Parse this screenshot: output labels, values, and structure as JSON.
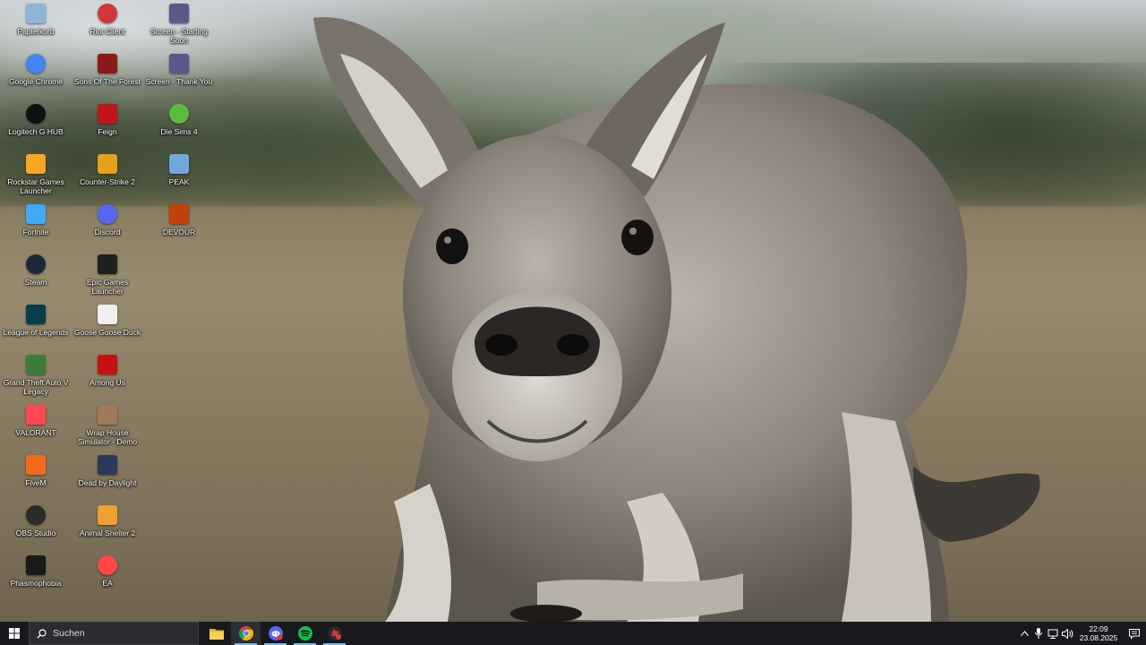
{
  "desktop": {
    "icons": [
      {
        "label": "Papierkorb",
        "icon": "recycle-bin-icon",
        "color": "#8fb3d9"
      },
      {
        "label": "Google Chrome",
        "icon": "chrome-icon",
        "color": "#4285f4"
      },
      {
        "label": "Logitech G HUB",
        "icon": "logitech-g-icon",
        "color": "#111111"
      },
      {
        "label": "Rockstar Games Launcher",
        "icon": "rockstar-icon",
        "color": "#f5a623"
      },
      {
        "label": "Fortnite",
        "icon": "fortnite-icon",
        "color": "#3fa9f5"
      },
      {
        "label": "Steam",
        "icon": "steam-icon",
        "color": "#1b2838"
      },
      {
        "label": "League of Legends",
        "icon": "league-of-legends-icon",
        "color": "#0a3d4a"
      },
      {
        "label": "Grand Theft Auto V Legacy",
        "icon": "gta-v-icon",
        "color": "#3c7d3a"
      },
      {
        "label": "VALORANT",
        "icon": "valorant-icon",
        "color": "#ff4655"
      },
      {
        "label": "FiveM",
        "icon": "fivem-icon",
        "color": "#f26b1d"
      },
      {
        "label": "OBS Studio",
        "icon": "obs-icon",
        "color": "#2b2b2b"
      },
      {
        "label": "Phasmophobia",
        "icon": "phasmophobia-icon",
        "color": "#1a1a1a"
      },
      {
        "label": "Riot Client",
        "icon": "riot-client-icon",
        "color": "#d13639"
      },
      {
        "label": "Sons Of The Forest",
        "icon": "sons-of-the-forest-icon",
        "color": "#8b1a1a"
      },
      {
        "label": "Feign",
        "icon": "feign-icon",
        "color": "#c0161b"
      },
      {
        "label": "Counter-Strike 2",
        "icon": "counter-strike-2-icon",
        "color": "#e4a11b"
      },
      {
        "label": "Discord",
        "icon": "discord-icon",
        "color": "#5865f2"
      },
      {
        "label": "Epic Games Launcher",
        "icon": "epic-games-icon",
        "color": "#202020"
      },
      {
        "label": "Goose Goose Duck",
        "icon": "goose-goose-duck-icon",
        "color": "#f0f0f0"
      },
      {
        "label": "Among Us",
        "icon": "among-us-icon",
        "color": "#c51111"
      },
      {
        "label": "Wrap House Simulator - Demo",
        "icon": "wrap-house-simulator-icon",
        "color": "#a0785a"
      },
      {
        "label": "Dead by Daylight",
        "icon": "dead-by-daylight-icon",
        "color": "#2a3a5a"
      },
      {
        "label": "Animal Shelter 2",
        "icon": "animal-shelter-2-icon",
        "color": "#f0a030"
      },
      {
        "label": "EA",
        "icon": "ea-icon",
        "color": "#ff4747"
      },
      {
        "label": "Screen - Starting Soon",
        "icon": "screen-starting-soon-icon",
        "color": "#5a5a8a"
      },
      {
        "label": "Screen - Thank You",
        "icon": "screen-thank-you-icon",
        "color": "#5a5a8a"
      },
      {
        "label": "Die Sims 4",
        "icon": "sims-4-icon",
        "color": "#5cbb3e"
      },
      {
        "label": "PEAK",
        "icon": "peak-icon",
        "color": "#6fa8dc"
      },
      {
        "label": "DEVOUR",
        "icon": "devour-icon",
        "color": "#c2410c"
      }
    ]
  },
  "taskbar": {
    "search_placeholder": "Suchen",
    "pinned": [
      {
        "name": "file-explorer",
        "icon": "folder-icon",
        "color": "#f3c74b"
      },
      {
        "name": "chrome",
        "icon": "chrome-icon",
        "color": "#4285f4"
      },
      {
        "name": "discord",
        "icon": "discord-icon",
        "color": "#5865f2"
      },
      {
        "name": "spotify",
        "icon": "spotify-icon",
        "color": "#1db954"
      },
      {
        "name": "riot-client",
        "icon": "riot-client-icon",
        "color": "#d13639"
      }
    ],
    "clock": {
      "time": "22:09",
      "date": "23.08.2025"
    }
  },
  "colors": {
    "taskbar_bg": "#17191c",
    "accent": "#76b9ed"
  }
}
